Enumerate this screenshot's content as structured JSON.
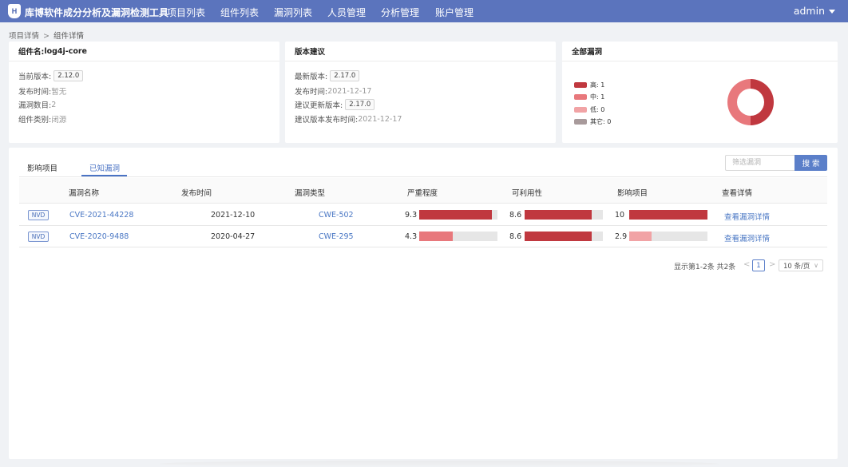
{
  "app": {
    "logo_text": "H",
    "title": "库博软件成分分析及漏洞检测工具",
    "nav": [
      "项目列表",
      "组件列表",
      "漏洞列表",
      "人员管理",
      "分析管理",
      "账户管理"
    ],
    "user": "admin"
  },
  "breadcrumb": {
    "parent": "项目详情",
    "separator": ">",
    "current": "组件详情"
  },
  "component_card": {
    "title_label": "组件名: ",
    "title_value": "log4j-core",
    "rows": [
      {
        "label": "当前版本: ",
        "value": "2.12.0",
        "boxed": true
      },
      {
        "label": "发布时间: ",
        "value": "暂无"
      },
      {
        "label": "漏洞数目: ",
        "value": "2"
      },
      {
        "label": "组件类别: ",
        "value": "闭源"
      }
    ]
  },
  "version_card": {
    "title": "版本建议",
    "rows": [
      {
        "label": "最新版本: ",
        "value": "2.17.0",
        "boxed": true
      },
      {
        "label": "发布时间: ",
        "value": "2021-12-17"
      },
      {
        "label": "建议更新版本: ",
        "value": "2.17.0",
        "boxed": true
      },
      {
        "label": "建议版本发布时间: ",
        "value": "2021-12-17"
      }
    ]
  },
  "vuln_card": {
    "title": "全部漏洞",
    "legend": [
      {
        "label": "高: 1",
        "color": "#c0383f"
      },
      {
        "label": "中: 1",
        "color": "#e8787c"
      },
      {
        "label": "低: 0",
        "color": "#f1a3a5"
      },
      {
        "label": "其它: 0",
        "color": "#a89a9b"
      }
    ],
    "chart_data": {
      "type": "pie",
      "categories": [
        "高",
        "中",
        "低",
        "其它"
      ],
      "values": [
        1,
        1,
        0,
        0
      ],
      "colors": [
        "#c0383f",
        "#e8787c",
        "#f1a3a5",
        "#a89a9b"
      ],
      "donut": true
    }
  },
  "tabs": [
    {
      "label": "影响项目",
      "active": false
    },
    {
      "label": "已知漏洞",
      "active": true
    }
  ],
  "search": {
    "placeholder": "筛选漏洞",
    "button": "搜 索"
  },
  "table": {
    "headers": [
      "漏洞名称",
      "发布时间",
      "漏洞类型",
      "严重程度",
      "可利用性",
      "影响项目",
      "查看详情"
    ],
    "rows": [
      {
        "source": "NVD",
        "cve": "CVE-2021-44228",
        "date": "2021-12-10",
        "cwe": "CWE-502",
        "severity": {
          "text": "9.3",
          "value": 9.3,
          "color": "#c0383f"
        },
        "exploitability": {
          "text": "8.6",
          "value": 8.6,
          "color": "#c0383f"
        },
        "impact": {
          "text": "10",
          "value": 10,
          "color": "#c0383f"
        },
        "detail": "查看漏洞详情"
      },
      {
        "source": "NVD",
        "cve": "CVE-2020-9488",
        "date": "2020-04-27",
        "cwe": "CWE-295",
        "severity": {
          "text": "4.3",
          "value": 4.3,
          "color": "#e8787c"
        },
        "exploitability": {
          "text": "8.6",
          "value": 8.6,
          "color": "#c0383f"
        },
        "impact": {
          "text": "2.9",
          "value": 2.9,
          "color": "#f1a3a5"
        },
        "detail": "查看漏洞详情"
      }
    ]
  },
  "pagination": {
    "summary": "显示第1-2条 共2条",
    "prev": "<",
    "page": "1",
    "next": ">",
    "page_size": "10 条/页",
    "chevron": "∨"
  }
}
